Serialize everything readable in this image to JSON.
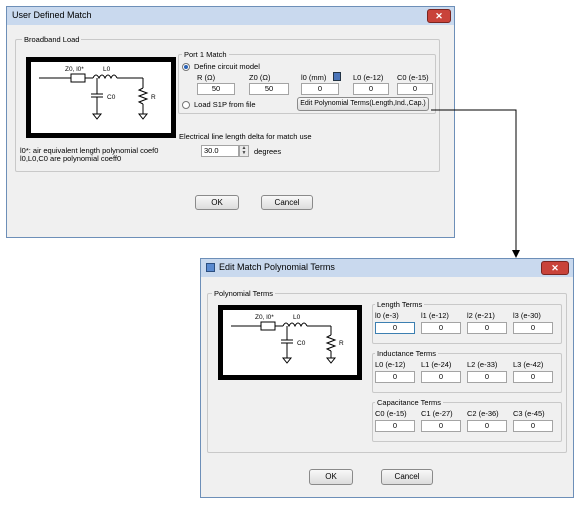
{
  "dialog1": {
    "title": "User Defined Match",
    "broadband_label": "Broadband Load",
    "schematic": {
      "z0_label": "Z0, l0*",
      "l0_label": "L0",
      "c0_label": "C0",
      "r_label": "R"
    },
    "notes": [
      "l0*: air equivalent length polynomial coef0",
      "l0,L0,C0 are polynomial coeff0"
    ],
    "port_match_label": "Port 1 Match",
    "define_label": "Define circuit model",
    "load_label": "Load S1P from file",
    "fields": [
      {
        "label": "R (Ω)",
        "value": "50"
      },
      {
        "label": "Z0 (Ω)",
        "value": "50"
      },
      {
        "label": "l0 (mm)",
        "value": "0"
      },
      {
        "label": "L0 (e-12)",
        "value": "0"
      },
      {
        "label": "C0 (e-15)",
        "value": "0"
      }
    ],
    "edit_button": "Edit Polynomial Terms(Length,Ind.,Cap.)",
    "delta_label": "Electrical line length delta for match use",
    "delta_value": "30.0",
    "degrees_label": "degrees",
    "ok": "OK",
    "cancel": "Cancel"
  },
  "dialog2": {
    "title": "Edit Match Polynomial Terms",
    "group_label": "Polynomial Terms",
    "schematic": {
      "z0_label": "Z0, l0*",
      "l0_label": "L0",
      "c0_label": "C0",
      "r_label": "R"
    },
    "length": {
      "label": "Length Terms",
      "cols": [
        "l0 (e-3)",
        "l1 (e-12)",
        "l2 (e-21)",
        "l3 (e-30)"
      ],
      "values": [
        "0",
        "0",
        "0",
        "0"
      ]
    },
    "inductance": {
      "label": "Inductance Terms",
      "cols": [
        "L0 (e-12)",
        "L1 (e-24)",
        "L2 (e-33)",
        "L3 (e-42)"
      ],
      "values": [
        "0",
        "0",
        "0",
        "0"
      ]
    },
    "capacitance": {
      "label": "Capacitance Terms",
      "cols": [
        "C0 (e-15)",
        "C1 (e-27)",
        "C2 (e-36)",
        "C3 (e-45)"
      ],
      "values": [
        "0",
        "0",
        "0",
        "0"
      ]
    },
    "ok": "OK",
    "cancel": "Cancel"
  },
  "colors": {
    "titlebar": "#c9d9ee",
    "close": "#c9433a",
    "window_bg": "#f0f0f0",
    "radio_accent": "#2b62b5"
  }
}
